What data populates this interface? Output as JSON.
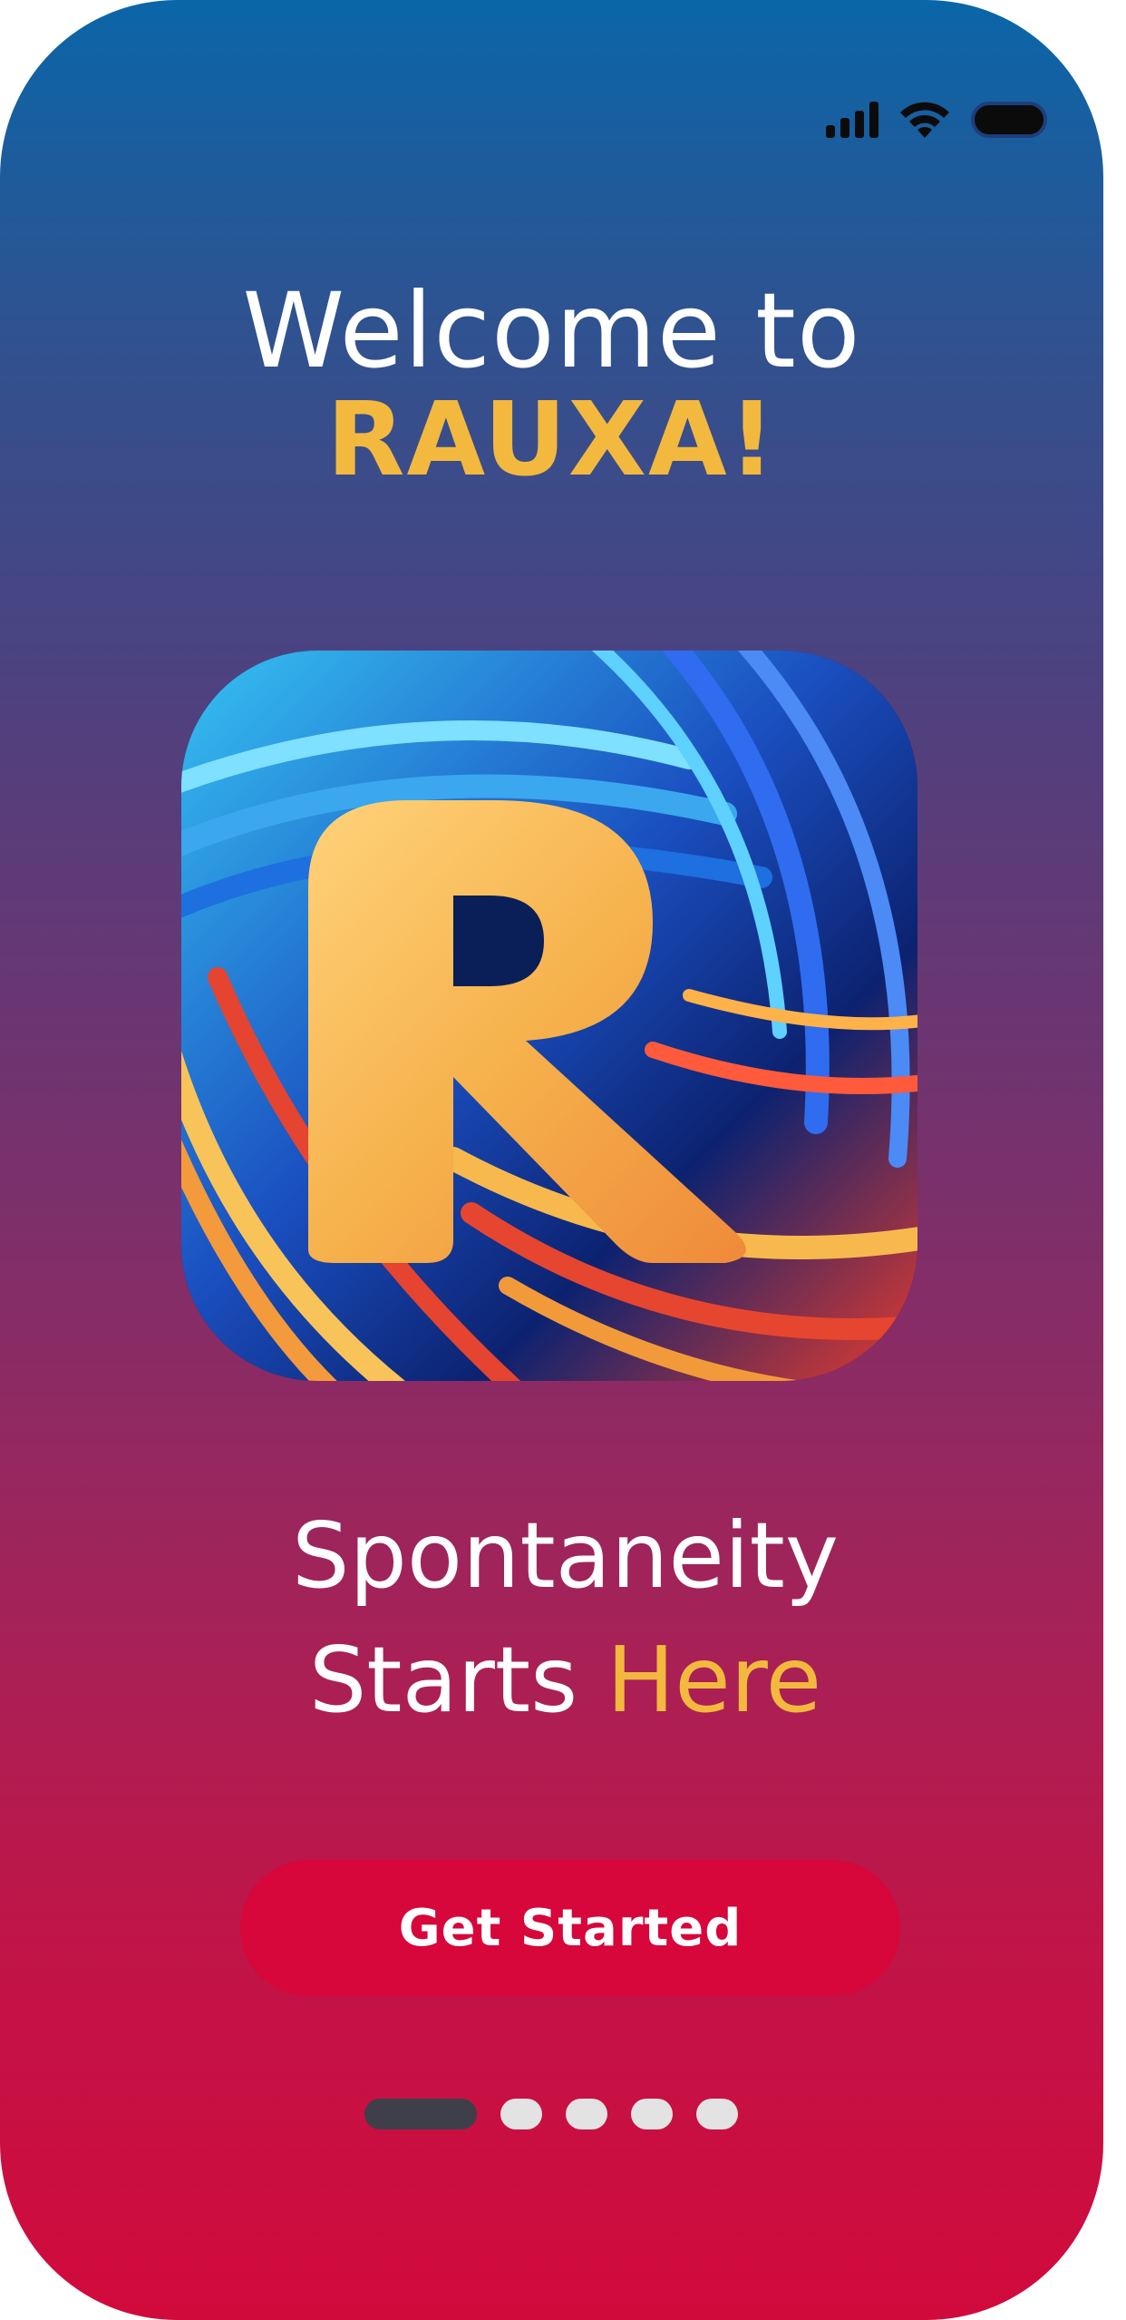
{
  "welcome": {
    "line1": "Welcome to",
    "line2": "RAUXA!"
  },
  "tagline": {
    "line1": "Spontaneity",
    "line2_white": "Starts ",
    "line2_accent": "Here"
  },
  "cta": {
    "label": "Get Started"
  },
  "pager": {
    "count": 5,
    "active_index": 0
  },
  "status_bar": {
    "icons": [
      "cellular-signal-icon",
      "wifi-icon",
      "battery-icon"
    ]
  },
  "colors": {
    "accent_yellow": "#f3b93e",
    "button_red": "#d7063b",
    "gradient_top": "#0a66a8",
    "gradient_bottom": "#d10a3c"
  }
}
